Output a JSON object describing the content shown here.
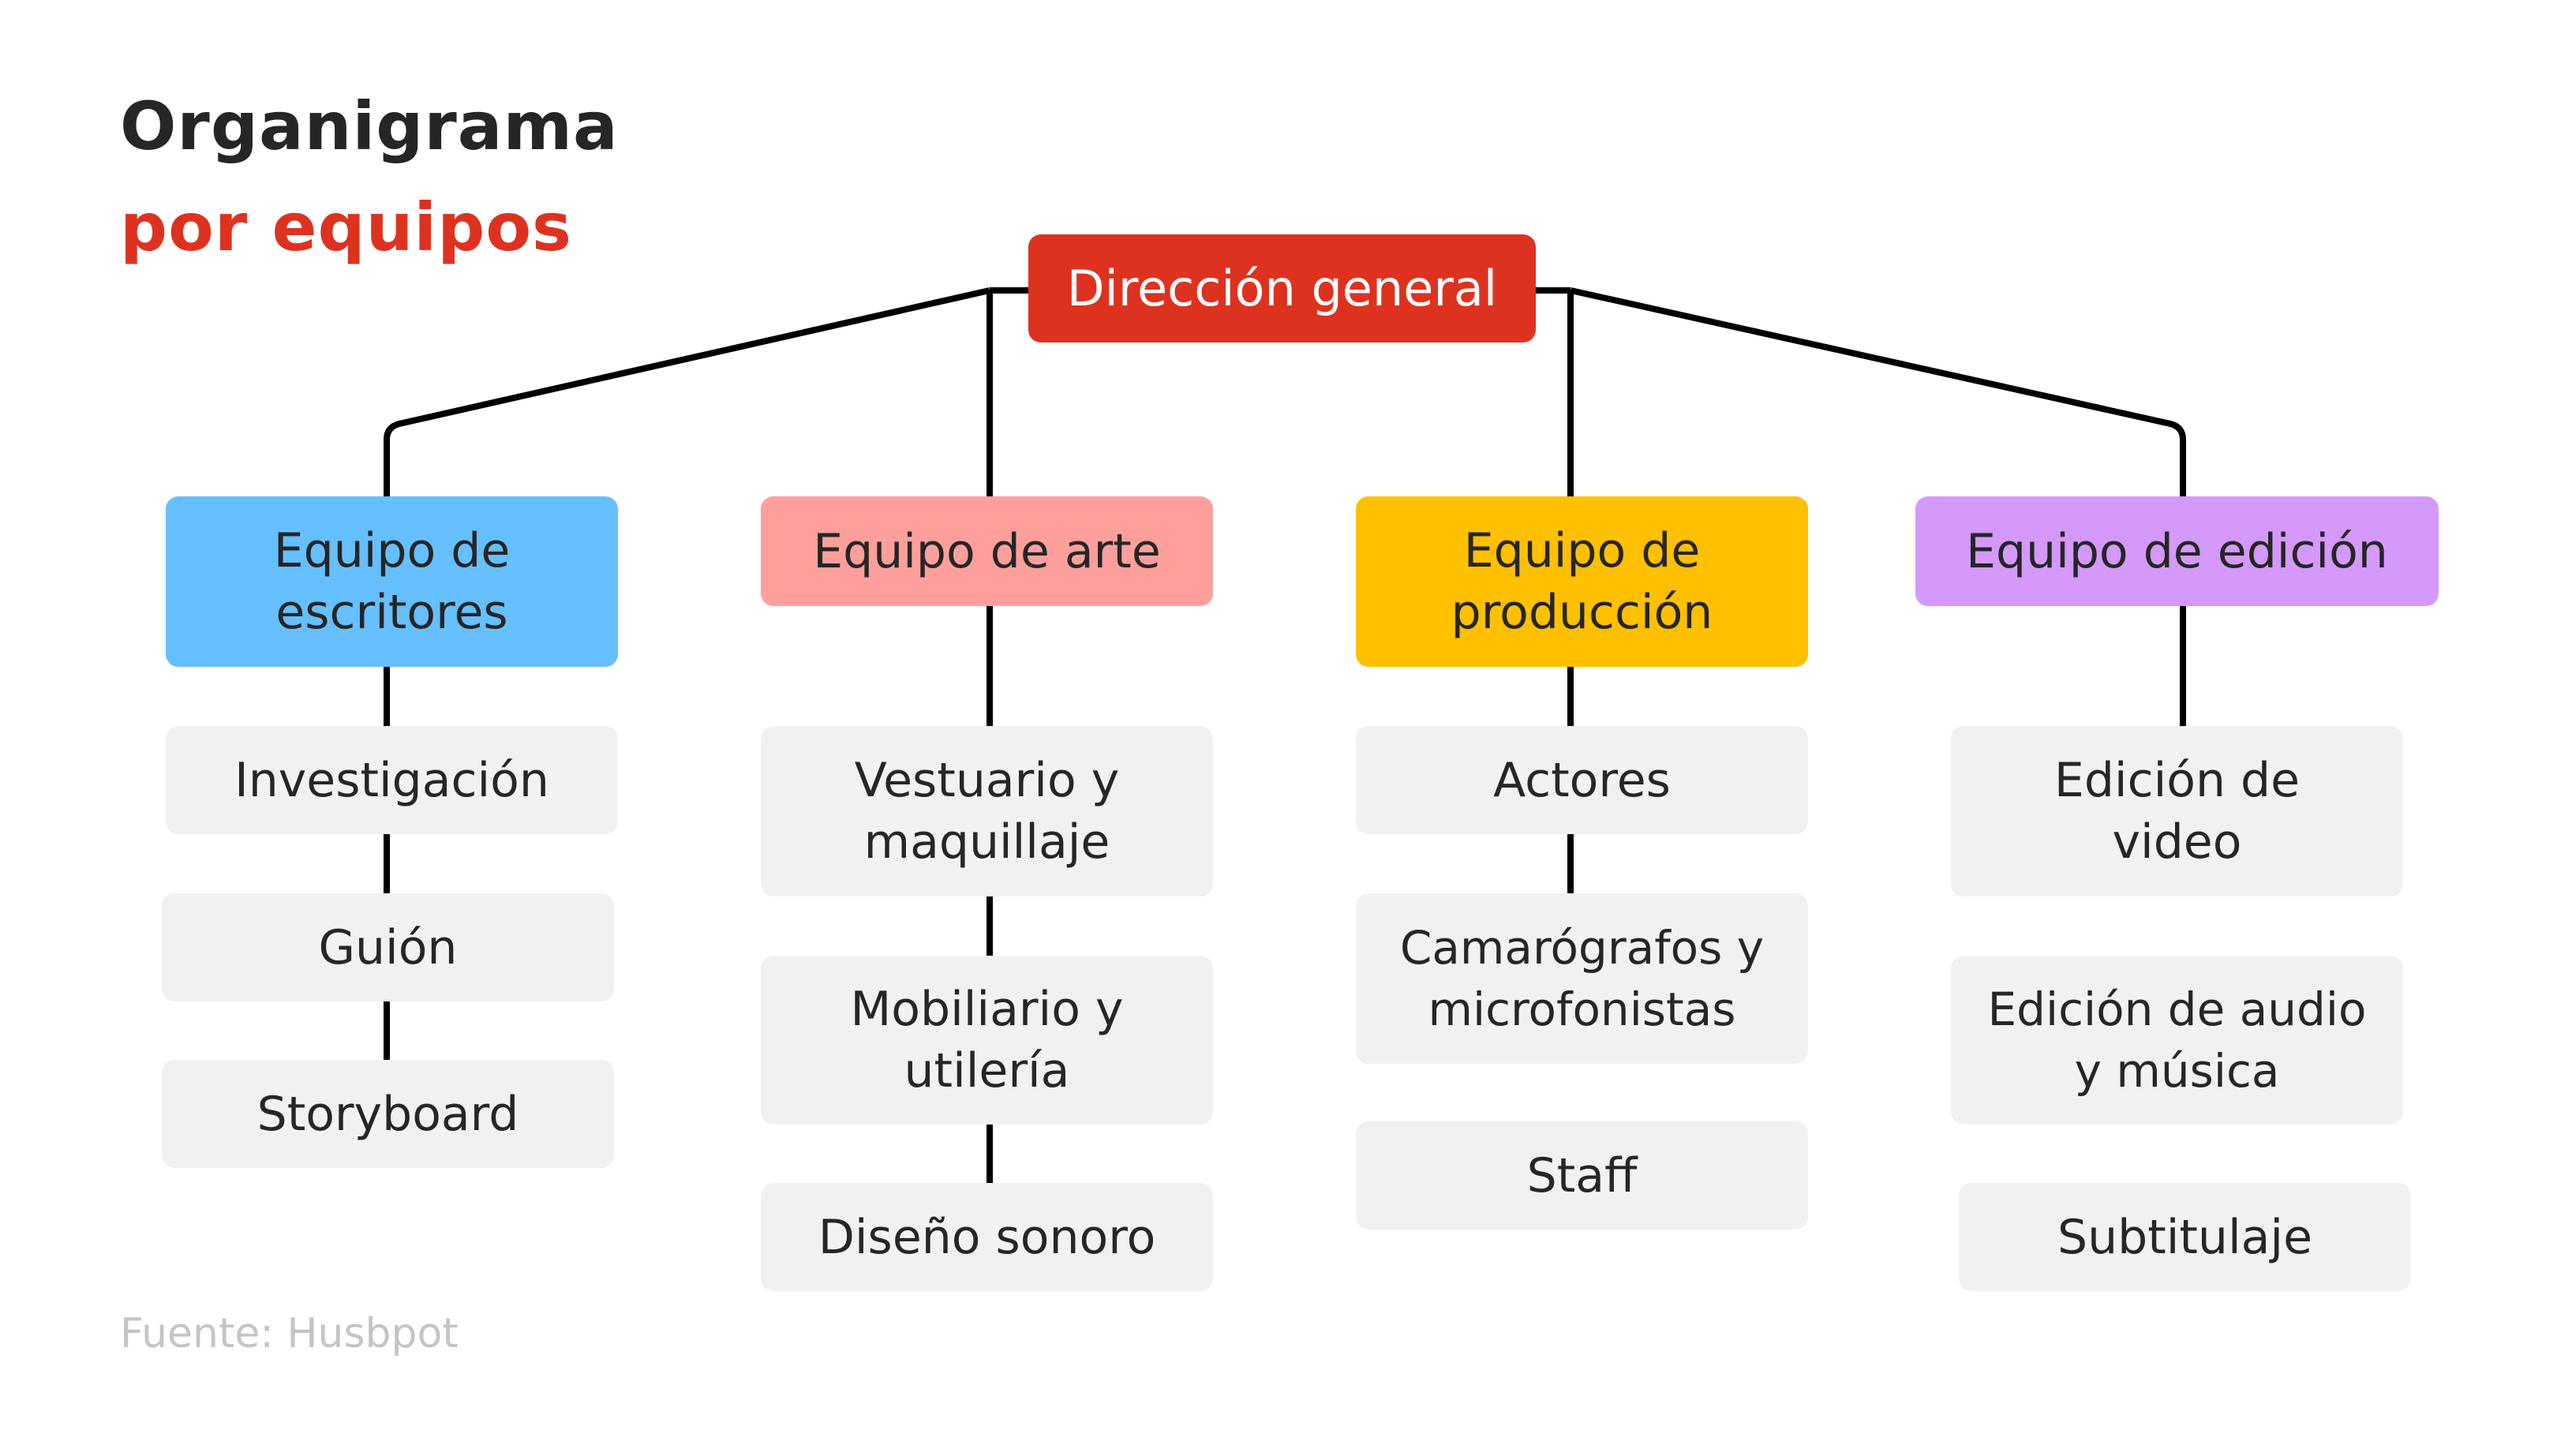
{
  "title": {
    "line1": "Organigrama",
    "line2": "por equipos"
  },
  "colors": {
    "accent": "#de3220",
    "dark_text": "#262626",
    "sub_box": "#f1f1f1",
    "footer": "#c4c4c4"
  },
  "root": {
    "label": "Dirección general",
    "color": "#de3220"
  },
  "teams": [
    {
      "label": "Equipo de escritores",
      "color": "#66bfff",
      "items": [
        "Investigación",
        "Guión",
        "Storyboard"
      ]
    },
    {
      "label": "Equipo de arte",
      "color": "#ff9f9c",
      "items": [
        "Vestuario y maquillaje",
        "Mobiliario y utilería",
        "Diseño sonoro"
      ]
    },
    {
      "label": "Equipo de producción",
      "color": "#ffc000",
      "items": [
        "Actores",
        "Camarógrafos y microfonistas",
        "Staff"
      ]
    },
    {
      "label": "Equipo de edición",
      "color": "#d499fb",
      "items": [
        "Edición de video",
        "Edición de audio y música",
        "Subtitulaje"
      ]
    }
  ],
  "footer": "Fuente: Husbpot"
}
